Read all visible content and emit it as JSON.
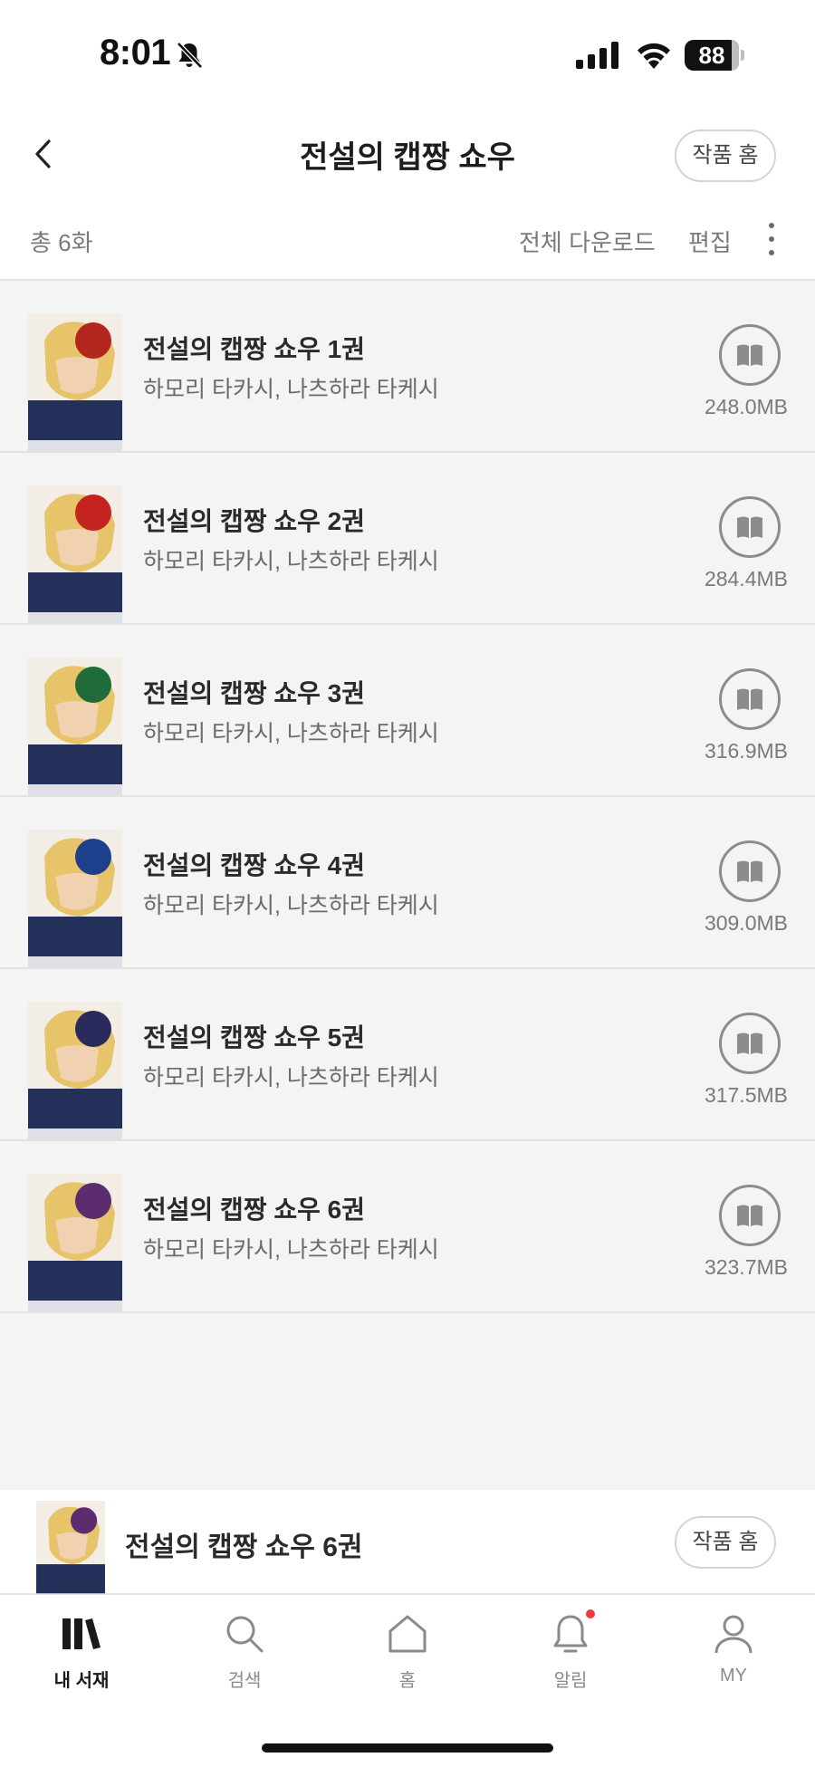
{
  "status_bar": {
    "time": "8:01",
    "battery": "88"
  },
  "header": {
    "title": "전설의 캡짱 쇼우",
    "work_home_label": "작품 홈"
  },
  "toolbar": {
    "total": "총 6화",
    "download_all": "전체 다운로드",
    "edit": "편집"
  },
  "volumes": [
    {
      "title": "전설의 캡짱 쇼우 1권",
      "author": "하모리 타카시, 나츠하라 타케시",
      "size": "248.0MB",
      "cover_color": "#b3261e"
    },
    {
      "title": "전설의 캡짱 쇼우 2권",
      "author": "하모리 타카시, 나츠하라 타케시",
      "size": "284.4MB",
      "cover_color": "#c4241f"
    },
    {
      "title": "전설의 캡짱 쇼우 3권",
      "author": "하모리 타카시, 나츠하라 타케시",
      "size": "316.9MB",
      "cover_color": "#1f6b3a"
    },
    {
      "title": "전설의 캡짱 쇼우 4권",
      "author": "하모리 타카시, 나츠하라 타케시",
      "size": "309.0MB",
      "cover_color": "#1d3f8c"
    },
    {
      "title": "전설의 캡짱 쇼우 5권",
      "author": "하모리 타카시, 나츠하라 타케시",
      "size": "317.5MB",
      "cover_color": "#2b2a5c"
    },
    {
      "title": "전설의 캡짱 쇼우 6권",
      "author": "하모리 타카시, 나츠하라 타케시",
      "size": "323.7MB",
      "cover_color": "#5b2d6e"
    }
  ],
  "mini_bar": {
    "title": "전설의 캡짱 쇼우 6권",
    "work_home_label": "작품 홈"
  },
  "tabs": [
    {
      "label": "내 서재",
      "icon": "library-icon",
      "active": true
    },
    {
      "label": "검색",
      "icon": "search-icon",
      "active": false
    },
    {
      "label": "홈",
      "icon": "home-icon",
      "active": false
    },
    {
      "label": "알림",
      "icon": "bell-icon",
      "active": false,
      "has_badge": true
    },
    {
      "label": "MY",
      "icon": "person-icon",
      "active": false
    }
  ],
  "colors": {
    "background": "#f4f4f4",
    "notification_dot": "#ef3b3b",
    "accent_text": "#1a1a1a"
  }
}
